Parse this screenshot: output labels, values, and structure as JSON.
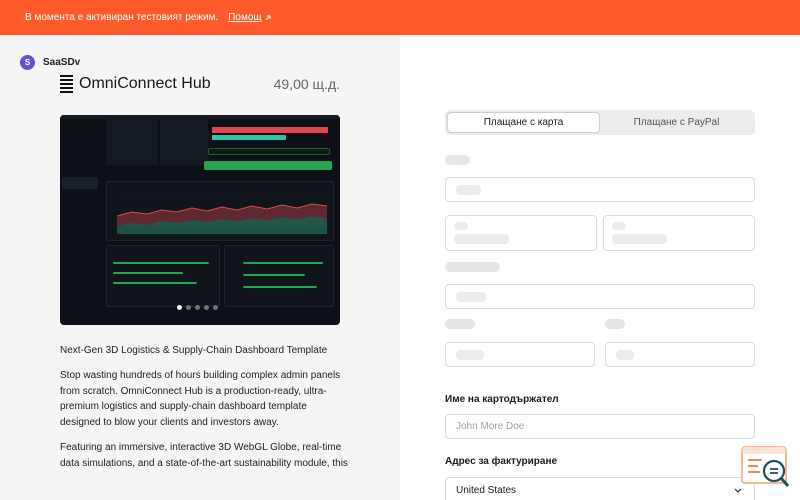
{
  "banner": {
    "text": "В момента е активиран тестовият режим.",
    "help_label": "Помощ"
  },
  "brand": {
    "initial": "S",
    "name": "SaaSDv"
  },
  "product": {
    "name": "OmniConnect Hub",
    "price": "49,00 щ.д."
  },
  "carousel": {
    "slides": 5,
    "active_index": 0
  },
  "description": {
    "title": "Next-Gen 3D Logistics & Supply-Chain Dashboard Template",
    "paragraph1": "Stop wasting hundreds of hours building complex admin panels from scratch. OmniConnect Hub is a production-ready, ultra-premium logistics and supply-chain dashboard template designed to blow your clients and investors away.",
    "paragraph2": "Featuring an immersive, interactive 3D WebGL Globe, real-time data simulations, and a state-of-the-art sustainability module, this"
  },
  "payment": {
    "tab_card": "Плащане с карта",
    "tab_paypal": "Плащане с PayPal",
    "cardholder_label": "Име на картодържател",
    "cardholder_placeholder": "John More Doe",
    "billing_label": "Адрес за фактуриране",
    "country_value": "United States"
  },
  "colors": {
    "banner": "#fd5b2c",
    "brand_avatar": "#6b4fd8"
  }
}
